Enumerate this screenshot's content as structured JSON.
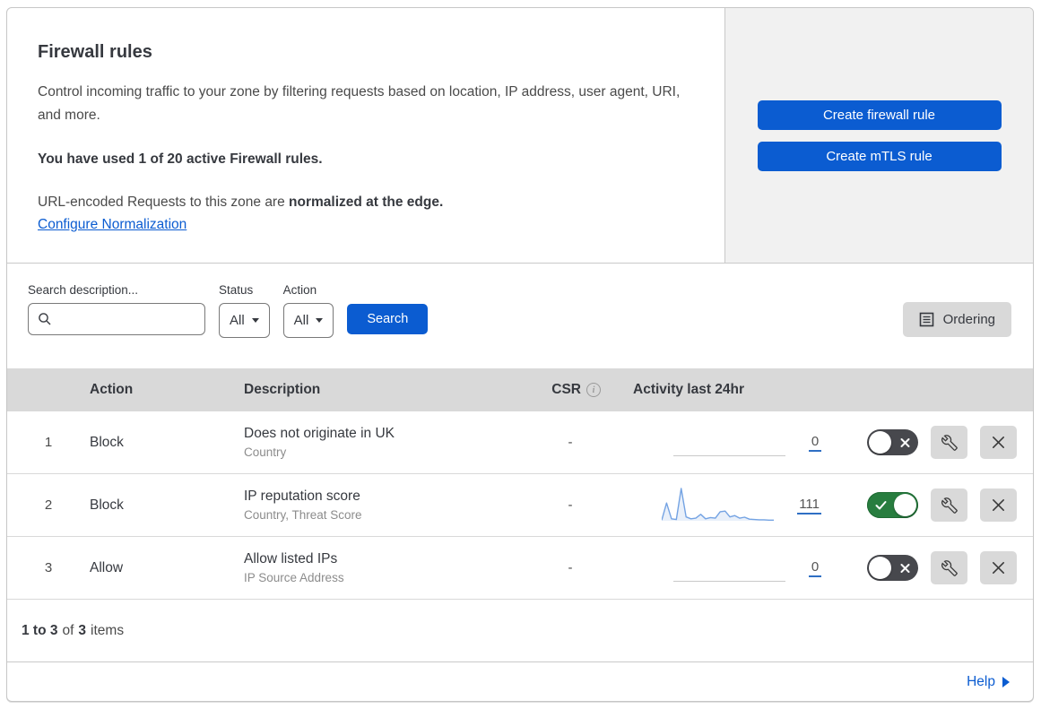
{
  "header": {
    "title": "Firewall rules",
    "description": "Control incoming traffic to your zone by filtering requests based on location, IP address, user agent, URI, and more.",
    "usage": "You have used 1 of 20 active Firewall rules.",
    "normalization_text": "URL-encoded Requests to this zone are",
    "normalization_bold": "normalized at the edge.",
    "normalization_link": "Configure Normalization"
  },
  "actions_panel": {
    "create_firewall_label": "Create firewall rule",
    "create_mtls_label": "Create mTLS rule"
  },
  "filters": {
    "search_label": "Search description...",
    "status_label": "Status",
    "status_value": "All",
    "action_label": "Action",
    "action_value": "All",
    "search_button": "Search",
    "ordering_button": "Ordering"
  },
  "table": {
    "columns": {
      "action": "Action",
      "description": "Description",
      "csr": "CSR",
      "activity": "Activity last 24hr"
    },
    "rows": [
      {
        "index": "1",
        "action": "Block",
        "description": "Does not originate in UK",
        "fields": "Country",
        "csr": "-",
        "activity_count": "0",
        "toggle": "off"
      },
      {
        "index": "2",
        "action": "Block",
        "description": "IP reputation score",
        "fields": "Country, Threat Score",
        "csr": "-",
        "activity_count": "111",
        "toggle": "on"
      },
      {
        "index": "3",
        "action": "Allow",
        "description": "Allow listed IPs",
        "fields": "IP Source Address",
        "csr": "-",
        "activity_count": "0",
        "toggle": "off"
      }
    ]
  },
  "footer": {
    "range_bold": "1 to 3",
    "of_text": "of",
    "total_bold": "3",
    "items_text": "items",
    "help_label": "Help"
  },
  "colors": {
    "accent_blue": "#0b5cd1",
    "toggle_on_green": "#287d3f",
    "toggle_off_gray": "#47484d",
    "table_header_gray": "#d9d9d9",
    "panel_gray": "#f1f1f1",
    "sparkline_blue": "#74a3e3"
  },
  "chart_data": {
    "type": "area",
    "context": "rule-2 activity sparkline, last 24hr",
    "values": [
      2,
      55,
      6,
      4,
      100,
      12,
      6,
      8,
      20,
      6,
      10,
      8,
      28,
      30,
      12,
      16,
      8,
      11,
      5,
      4,
      3,
      3,
      2,
      2
    ],
    "total": 111,
    "ylim": [
      0,
      100
    ],
    "grid": false
  }
}
